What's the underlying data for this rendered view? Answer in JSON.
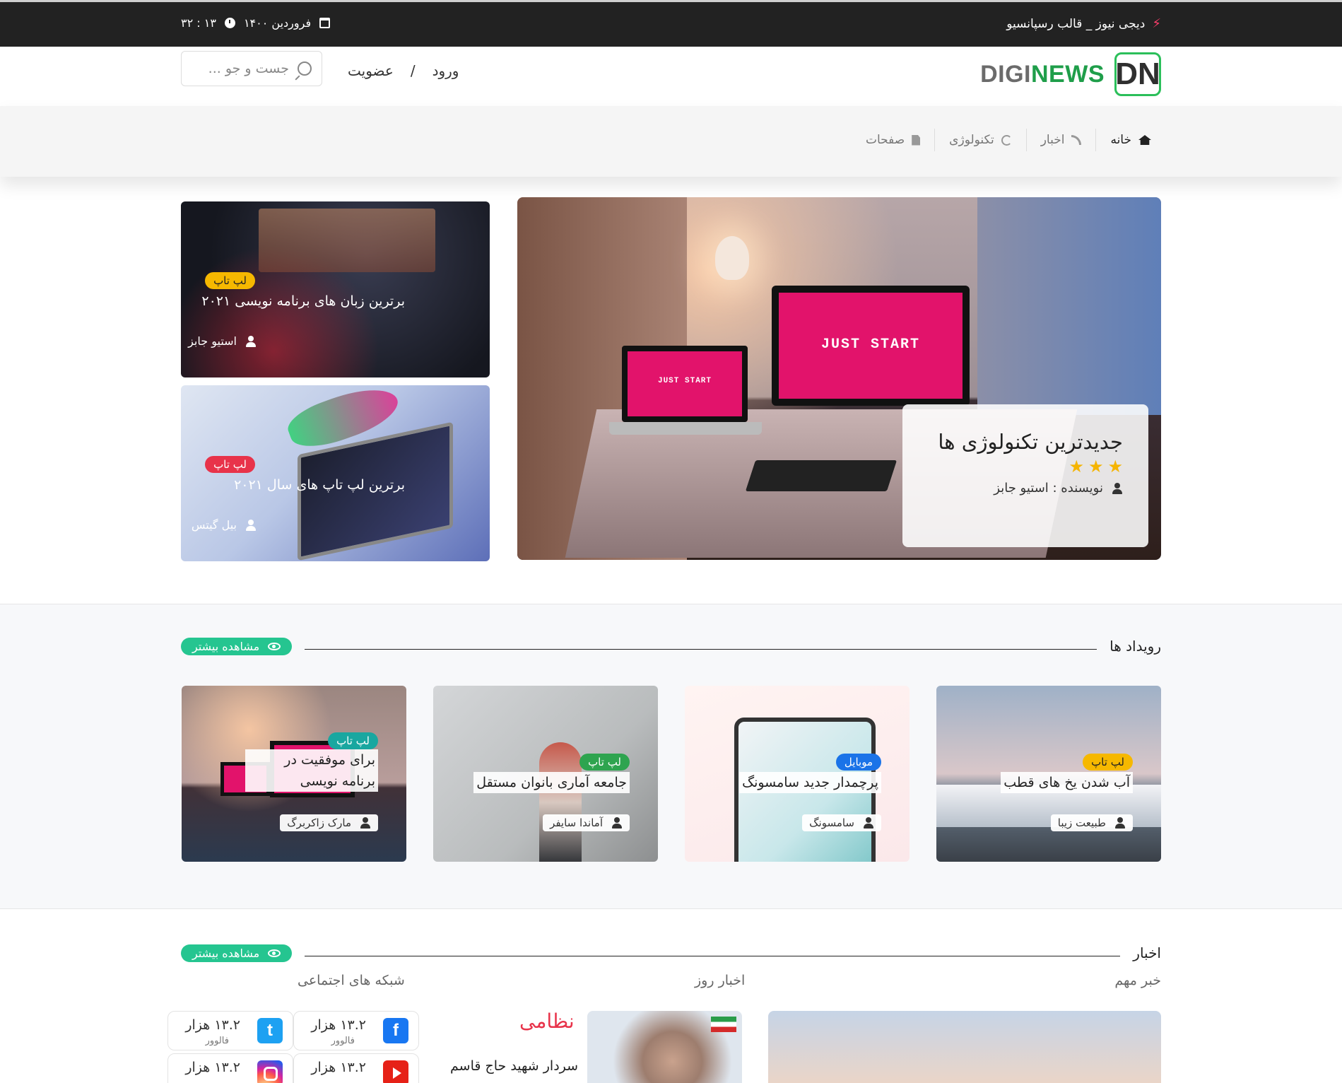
{
  "topbar": {
    "site_tagline": "دیجی نیوز _ قالب رسپانسیو",
    "date": "فروردین ۱۴۰۰",
    "time": "۱۳ : ۳۲"
  },
  "header": {
    "logo_text_gray": "DIGI",
    "logo_text_green": "NEWS",
    "logo_mark": "DN",
    "login": "ورود",
    "separator": "/",
    "register": "عضویت",
    "search_placeholder": "جست و جو ..."
  },
  "nav": {
    "items": [
      {
        "label": "خانه",
        "icon": "home-icon"
      },
      {
        "label": "اخبار",
        "icon": "rss-icon"
      },
      {
        "label": "تکنولوژی",
        "icon": "spinner-icon"
      },
      {
        "label": "صفحات",
        "icon": "file-icon"
      }
    ]
  },
  "hero": {
    "main": {
      "title": "جدیدترین تکنولوژی ها",
      "author": "نویسنده : استیو جابز",
      "rating": 3,
      "screen_text": "JUST START"
    },
    "side": [
      {
        "badge": "لپ تاپ",
        "title": "برترین زبان های برنامه نویسی ۲۰۲۱",
        "author": "استیو جابز"
      },
      {
        "badge": "لپ تاپ",
        "title": "برترین لپ تاپ های سال ۲۰۲۱",
        "author": "بیل گیتس"
      }
    ]
  },
  "events": {
    "title": "رویداد ها",
    "more": "مشاهده بیشتر",
    "cards": [
      {
        "badge": "لپ تاپ",
        "title": "آب شدن یخ های قطب",
        "author": "طبیعت زیبا"
      },
      {
        "badge": "موبایل",
        "title": "پرچمدار جدید سامسونگ",
        "author": "سامسونگ"
      },
      {
        "badge": "لپ تاپ",
        "title": "جامعه آماری بانوان مستقل",
        "author": "آماندا سایفر"
      },
      {
        "badge": "لپ تاپ",
        "title": "برای موفقیت در برنامه نویسی",
        "author": "مارک زاکربرگ"
      }
    ]
  },
  "news": {
    "title": "اخبار",
    "more": "مشاهده بیشتر",
    "col_important": "خبر مهم",
    "col_daily": "اخبار روز",
    "col_social": "شبکه های اجتماعی",
    "daily_category": "نظامی",
    "daily_text": "سردار شهید حاج قاسم",
    "social": [
      {
        "network": "facebook-icon",
        "count": "۱۳.۲ هزار",
        "sub": "فالوور"
      },
      {
        "network": "twitter-icon",
        "count": "۱۳.۲ هزار",
        "sub": "فالوور"
      },
      {
        "network": "youtube-icon",
        "count": "۱۳.۲ هزار",
        "sub": ""
      },
      {
        "network": "instagram-icon",
        "count": "۱۳.۲ هزار",
        "sub": ""
      }
    ]
  }
}
